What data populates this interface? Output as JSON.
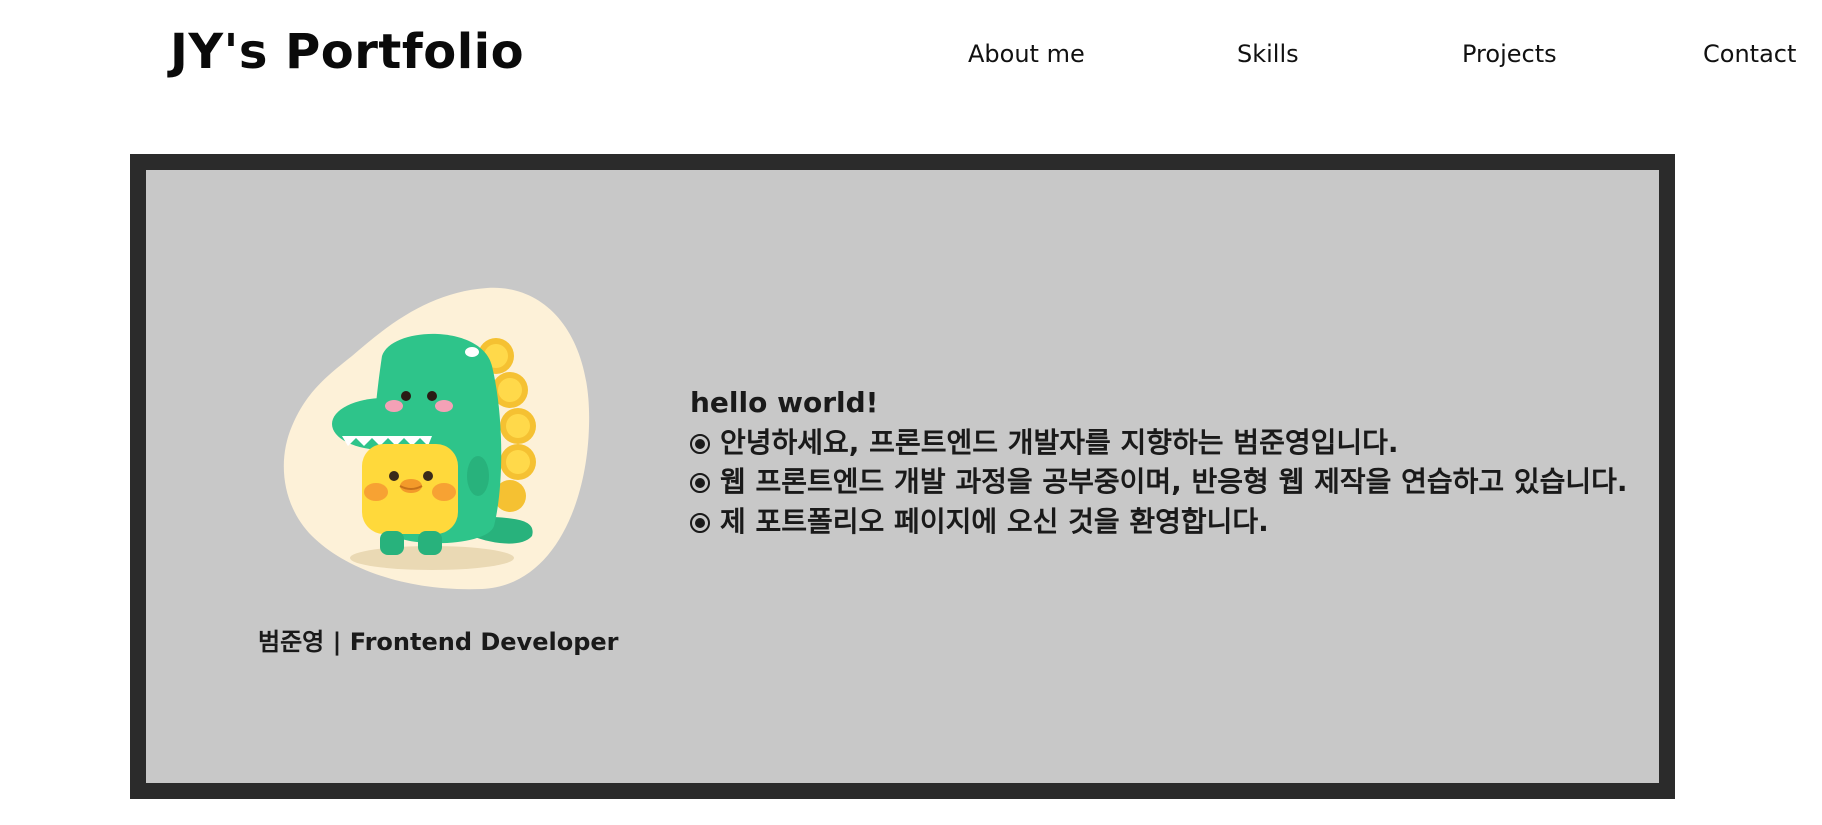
{
  "header": {
    "logo": "JY's Portfolio",
    "nav": [
      "About me",
      "Skills",
      "Projects",
      "Contact"
    ]
  },
  "profile": {
    "avatar_icon": "green-dinosaur-costume-chick-illustration",
    "caption": "범준영 | Frontend Developer"
  },
  "intro": {
    "greeting": "hello world!",
    "lines": [
      "안녕하세요, 프론트엔드 개발자를 지향하는 범준영입니다.",
      "웹 프론트엔드 개발 과정을 공부중이며, 반응형 웹 제작을 연습하고 있습니다.",
      "제 포트폴리오 페이지에 오신 것을 환영합니다."
    ],
    "bullet_icon": "fisheye-bullet-icon"
  },
  "colors": {
    "frame": "#2b2b2b",
    "panel": "#c8c8c8",
    "text": "#1a1a1a",
    "blob": "#fdf1d8",
    "dino_green": "#2ec48a",
    "chick_yellow": "#ffd93b"
  }
}
